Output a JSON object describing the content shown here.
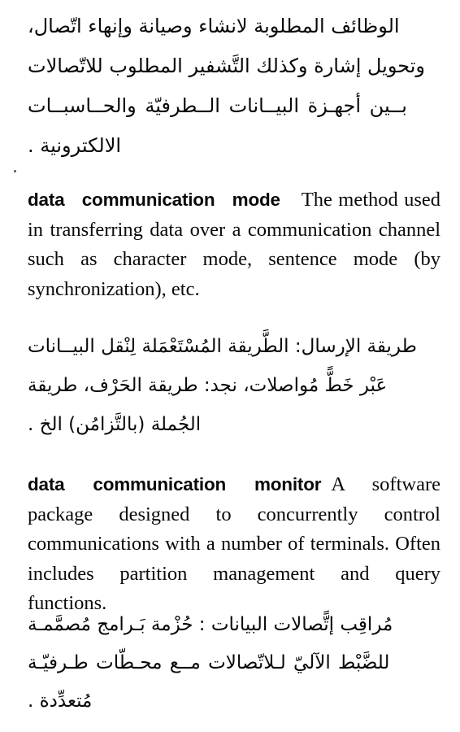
{
  "page": {
    "type": "bilingual-dictionary-page",
    "background_color": "#ffffff",
    "text_color": "#0a0a0a",
    "language_primary": "en",
    "language_secondary": "ar"
  },
  "arabic_top_paragraph": {
    "direction": "rtl",
    "lines": [
      "الوظائف المطلوبة لانشاء وصيانة وإنهاء اتّصال،",
      "وتحويل إشارة وكذلك التَّشفير المطلوب للاتّصالات",
      "بــين أجهـزة البيــانات الــطرفيّة والحــاسبــات",
      "الالكترونية ."
    ]
  },
  "entries": [
    {
      "headword": "data communication mode",
      "definition": "The method used in transferring data over a communication channel such as character mode, sentence mode (by synchronization), etc.",
      "arabic_translation": {
        "direction": "rtl",
        "headword": "طريقة الإرسال",
        "separator": ":",
        "body": "الطَّريقة المُسْتَعْمَلة لِنْقل البيانات عَبْر خَطًّ مُواصلات، نجد: طريقة الحَرْف، طريقة الجُملة (بالتَّزامُن) الخ .",
        "lines": [
          "طريقة الإرسال: الطَّريقة المُسْتَعْمَلة لِنْقل البيــانات",
          "عَبْر خَطًّ مُواصلات، نجد: طريقة الحَرْف، طريقة",
          "الجُملة (بالتَّزامُن) الخ ."
        ]
      }
    },
    {
      "headword": "data communication monitor",
      "definition": "A software package designed to concurrently control communications with a number of terminals. Often includes partition management and query functions.",
      "arabic_translation": {
        "direction": "rtl",
        "headword": "مُراقِب إتًّصالات البيانات",
        "separator": ":",
        "body": "حُزْمة بَرامج مُصمَّمة للضَّبْط الآليّ للاتّصالات مع محطّات طرفيّة مُتعدِّدة .",
        "lines": [
          "مُراقِب إتًّصالات البيانات : حُزْمة بَـرامج مُصمَّمـة",
          "للضَّبْط الآليّ لـلاتّصالات مــع محـطّات طـرفيّـة",
          "مُتعدِّدة ."
        ]
      }
    }
  ]
}
